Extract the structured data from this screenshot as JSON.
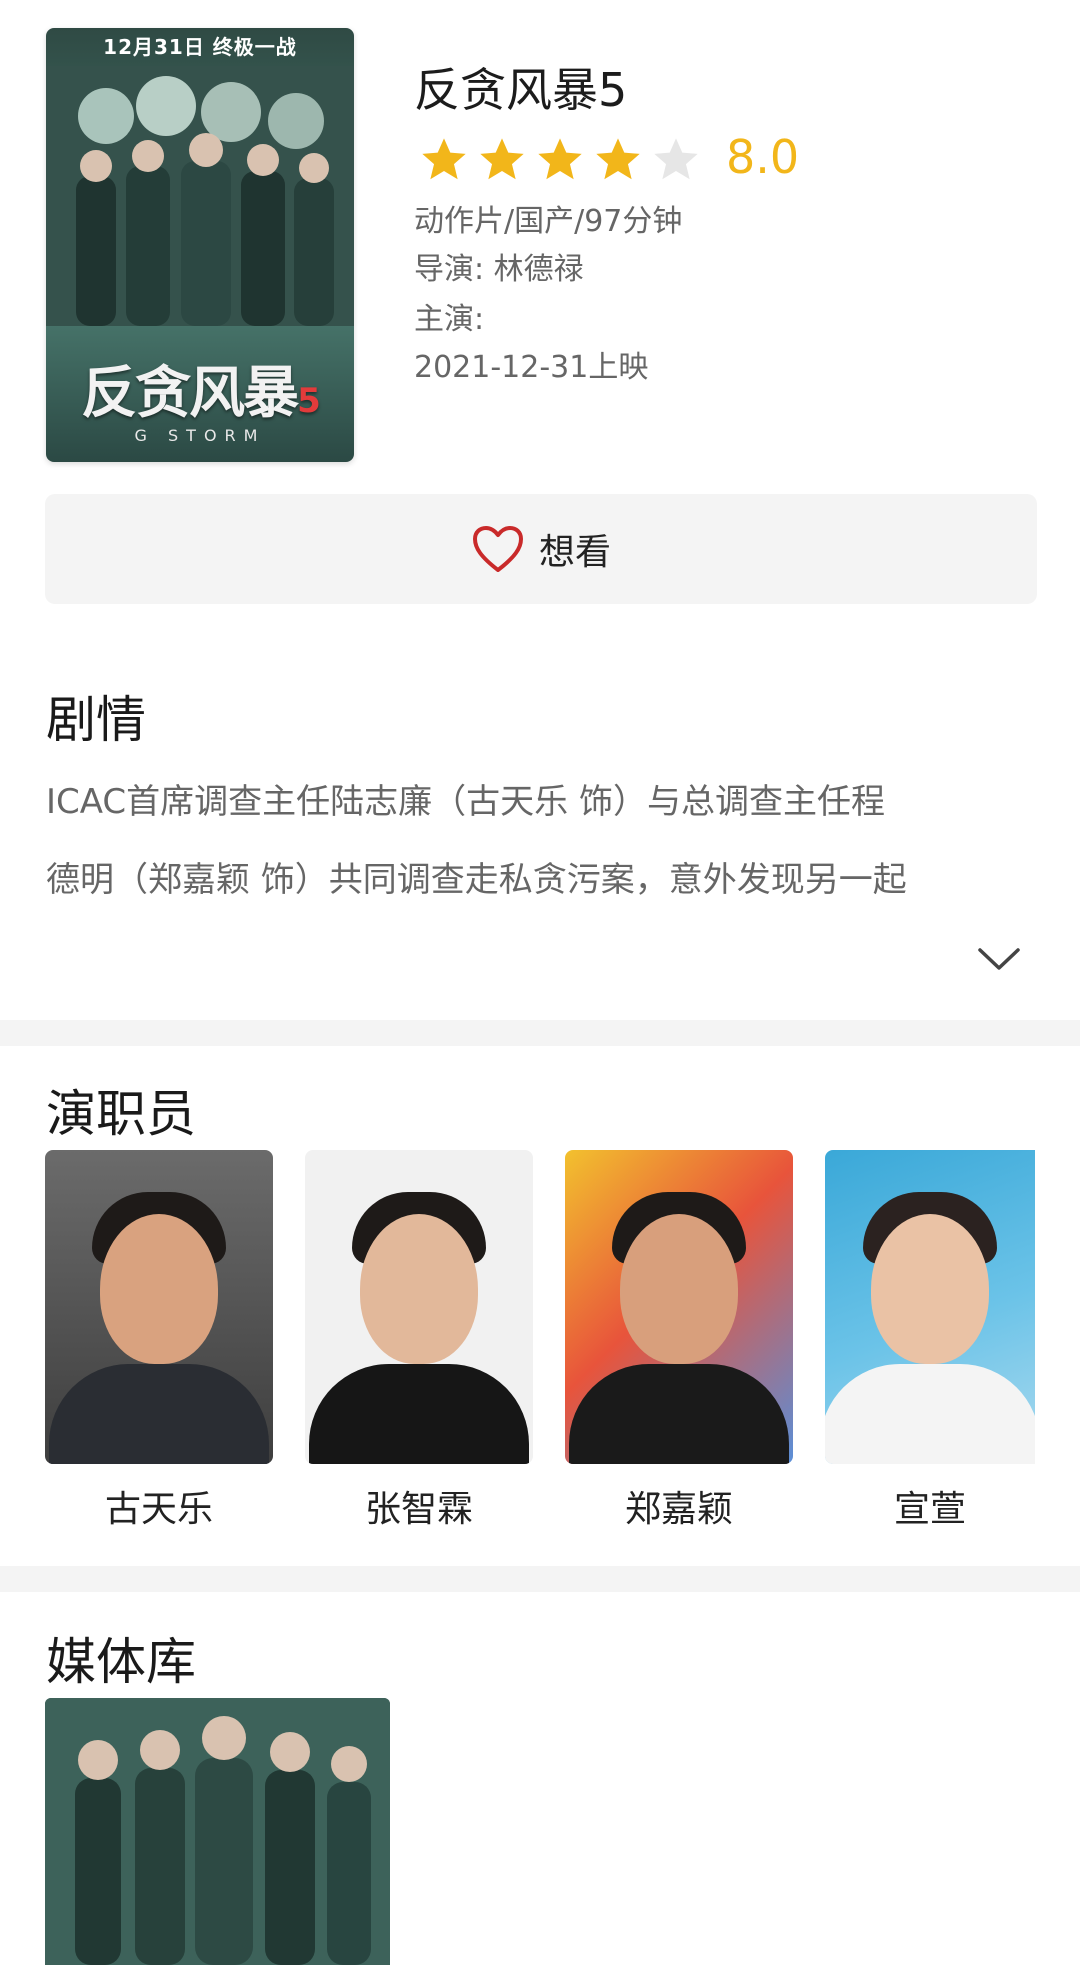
{
  "movie": {
    "title": "反贪风暴5",
    "rating": 8.0,
    "rating_text": "8.0",
    "stars_filled": 4,
    "stars_total": 5,
    "genre_line": "动作片/国产/97分钟",
    "director_line": "导演:  林德禄",
    "cast_line": "主演:",
    "release_line": "2021-12-31上映"
  },
  "poster": {
    "top_text": "12月31日  终极一战",
    "title_text": "反贪风暴",
    "title_num": "5",
    "subtitle": "G STORM"
  },
  "wish": {
    "label": "想看",
    "icon": "heart-outline-icon"
  },
  "plot": {
    "heading": "剧情",
    "lines": [
      "ICAC首席调查主任陆志廉（古天乐 饰）与总调查主任程",
      "德明（郑嘉颖 饰）共同调查走私贪污案，意外发现另一起"
    ],
    "expand_icon": "chevron-down-icon"
  },
  "cast": {
    "heading": "演职员",
    "members": [
      {
        "name": "古天乐"
      },
      {
        "name": "张智霖"
      },
      {
        "name": "郑嘉颖"
      },
      {
        "name": "宣萱"
      }
    ]
  },
  "media": {
    "heading": "媒体库"
  },
  "colors": {
    "star": "#f2b61a",
    "star_empty": "#e6e6e6",
    "heart": "#c92a2a",
    "text_secondary": "#666666",
    "divider": "#f4f4f4"
  }
}
